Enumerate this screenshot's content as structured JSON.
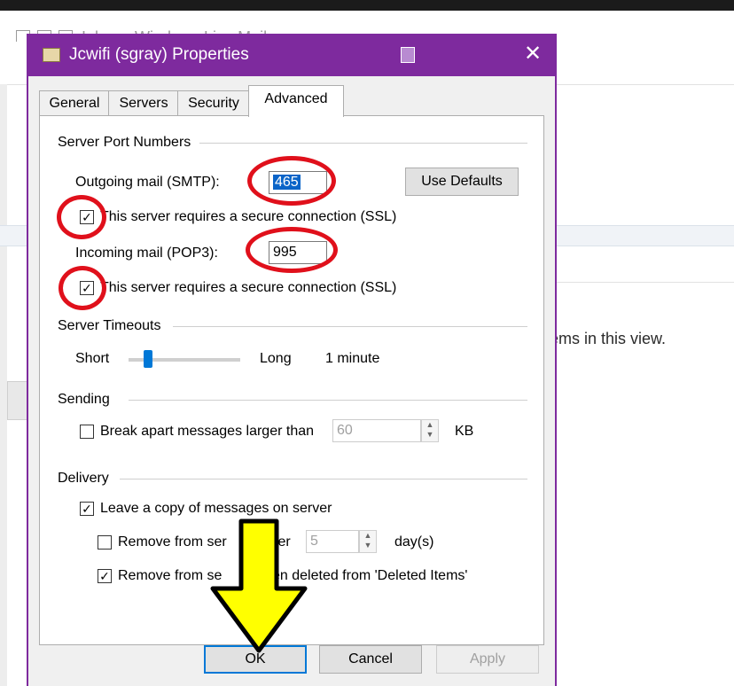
{
  "background": {
    "window_title": "Inbox - Windows Live Mail",
    "empty_text": "ems in this view."
  },
  "dialog": {
    "title": "Jcwifi (sgray) Properties",
    "close_glyph": "✕",
    "tabs": [
      {
        "label": "General"
      },
      {
        "label": "Servers"
      },
      {
        "label": "Security"
      },
      {
        "label": "Advanced"
      }
    ],
    "server_ports": {
      "group": "Server Port Numbers",
      "smtp_label": "Outgoing mail (SMTP):",
      "smtp_value": "465",
      "use_defaults": "Use Defaults",
      "smtp_ssl_label": "This server requires a secure connection (SSL)",
      "smtp_ssl_checked": "✓",
      "pop3_label": "Incoming mail (POP3):",
      "pop3_value": "995",
      "pop3_ssl_label": "This server requires a secure connection (SSL)",
      "pop3_ssl_checked": "✓"
    },
    "timeouts": {
      "group": "Server Timeouts",
      "short": "Short",
      "long": "Long",
      "value": "1 minute",
      "slider_fraction": 0.15
    },
    "sending": {
      "group": "Sending",
      "break_label": "Break apart messages larger than",
      "break_value": "60",
      "unit": "KB"
    },
    "delivery": {
      "group": "Delivery",
      "leave_copy_label": "Leave a copy of messages on server",
      "leave_copy_checked": "✓",
      "remove_after_label_a": "Remove from ser",
      "remove_after_label_b": "ter",
      "remove_after_value": "5",
      "remove_after_unit": "day(s)",
      "remove_deleted_label_a": "Remove from se",
      "remove_deleted_label_b": "en deleted from 'Deleted Items'",
      "remove_deleted_checked": "✓"
    },
    "buttons": {
      "ok": "OK",
      "cancel": "Cancel",
      "apply": "Apply"
    }
  },
  "annotations": {
    "ring_color": "#e0101b",
    "arrow_fill": "#ffff00"
  }
}
